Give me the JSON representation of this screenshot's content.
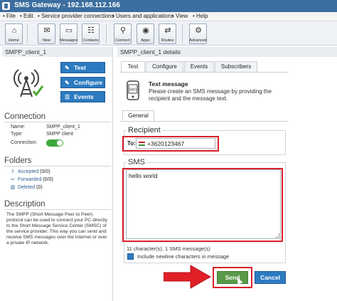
{
  "window": {
    "title": "SMS Gateway - 192.168.112.166"
  },
  "menu": [
    "• File",
    "• Edit",
    "• Service provider connections",
    "• Users and applications",
    "• View",
    "• Help"
  ],
  "toolbar": [
    {
      "label": "Home",
      "icon": "home-icon",
      "glyph": "⌂"
    },
    {
      "label": "New",
      "icon": "new-message-icon",
      "glyph": "✉"
    },
    {
      "label": "Messages",
      "icon": "folder-icon",
      "glyph": "▭"
    },
    {
      "label": "Contacts",
      "icon": "contacts-icon",
      "glyph": "☷"
    },
    {
      "label": "Connect",
      "icon": "antenna-icon",
      "glyph": "⚲"
    },
    {
      "label": "Apps",
      "icon": "apps-icon",
      "glyph": "◉"
    },
    {
      "label": "Routes",
      "icon": "routes-icon",
      "glyph": "⇄"
    },
    {
      "label": "Advanced",
      "icon": "gear-icon",
      "glyph": "⚙"
    }
  ],
  "left": {
    "header": "SMPP_client_1",
    "buttons": {
      "test": "Test",
      "configure": "Configure",
      "events": "Events"
    },
    "connection": {
      "heading": "Connection",
      "name_label": "Name:",
      "name_value": "SMPP_client_1",
      "type_label": "Type:",
      "type_value": "SMPP client",
      "connection_label": "Connection:",
      "connection_on": true
    },
    "folders": {
      "heading": "Folders",
      "items": [
        {
          "label": "Accepted",
          "count": "(0/0)"
        },
        {
          "label": "Forwarded",
          "count": "(0/0)"
        },
        {
          "label": "Deleted",
          "count": "(0)"
        }
      ]
    },
    "description": {
      "heading": "Description",
      "text": "The SMPP (Short Message Peer to Peer) protocol can be used to connect your PC directly to the Short Message Service Center (SMSC) of the service provider. This way you can send and receive SMS messages over the Internet or over a private IP network."
    }
  },
  "right": {
    "header": "SMPP_client_1 details",
    "tabs": [
      "Test",
      "Configure",
      "Events",
      "Subscribers"
    ],
    "active_tab": "Test",
    "intro": {
      "title": "Text message",
      "text": "Please create an SMS message by providing the recipient and the message text."
    },
    "subtab": "General",
    "recipient": {
      "legend": "Recipient",
      "to_label": "To:",
      "value": "+3620123467"
    },
    "sms": {
      "legend": "SMS",
      "text": "hello world",
      "counter": "11 character(s), 1 SMS message(s)"
    },
    "newline_option": {
      "label": "Include newline characters in message",
      "checked": true
    },
    "send_label": "Send",
    "cancel_label": "Cancel"
  },
  "colors": {
    "accent": "#2c7bc0",
    "highlight": "#d9202a",
    "titlebar": "#3c6e9f"
  }
}
